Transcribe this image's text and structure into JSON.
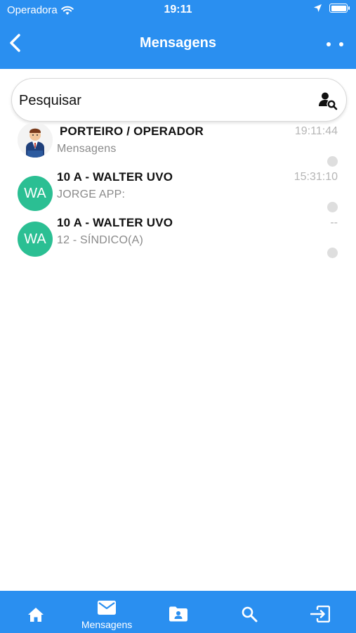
{
  "status_bar": {
    "carrier": "Operadora",
    "time": "19:11"
  },
  "header": {
    "title": "Mensagens"
  },
  "search": {
    "placeholder": "Pesquisar"
  },
  "conversations": [
    {
      "name": "PORTEIRO / OPERADOR",
      "preview": "Mensagens",
      "time": "19:11:44",
      "avatar_type": "image",
      "avatar_icon": "doorman-avatar-icon"
    },
    {
      "name": "10 A - WALTER UVO",
      "preview": "JORGE APP:",
      "time": "15:31:10",
      "avatar_type": "initials",
      "initials": "WA",
      "avatar_color": "#2bbf93"
    },
    {
      "name": "10 A - WALTER UVO",
      "preview": "12 - SÍNDICO(A)",
      "time": "--",
      "avatar_type": "initials",
      "initials": "WA",
      "avatar_color": "#2bbf93"
    }
  ],
  "tab_bar": {
    "active_label": "Mensagens",
    "tabs": [
      {
        "icon": "home-icon"
      },
      {
        "icon": "mail-icon",
        "label": "Mensagens"
      },
      {
        "icon": "contacts-folder-icon"
      },
      {
        "icon": "search-icon"
      },
      {
        "icon": "logout-icon"
      }
    ]
  },
  "colors": {
    "primary": "#2a8ff0",
    "avatar": "#2bbf93",
    "muted_text": "#8a8a8a",
    "time_text": "#b5b5b5"
  }
}
